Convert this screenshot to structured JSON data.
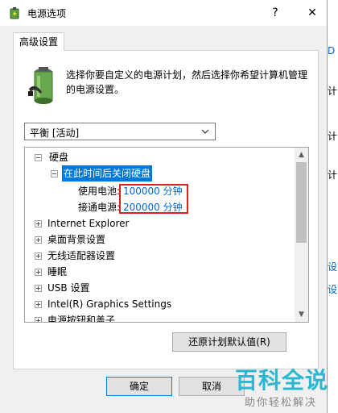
{
  "window": {
    "title": "电源选项",
    "help_label": "?",
    "close_label": "✕"
  },
  "tabs": [
    {
      "label": "高级设置"
    }
  ],
  "description": "选择你要自定义的电源计划，然后选择你希望计算机管理的电源设置。",
  "plan_select": {
    "value": "平衡 [活动]"
  },
  "tree": {
    "hard_disk": "硬盘",
    "turn_off_after": "在此时间后关闭硬盘",
    "on_battery_label": "使用电池:",
    "on_battery_value": "100000 分钟",
    "plugged_in_label": "接通电源:",
    "plugged_in_value": "200000 分钟",
    "items": [
      "Internet Explorer",
      "桌面背景设置",
      "无线适配器设置",
      "睡眠",
      "USB 设置",
      "Intel(R) Graphics Settings",
      "电源按钮和盖子"
    ]
  },
  "buttons": {
    "restore_defaults": "还原计划默认值(R)",
    "ok": "确定",
    "cancel": "取消"
  },
  "watermark": {
    "main": "百科全说",
    "sub": "助你轻松解决"
  },
  "background_window": {
    "char_top": "D",
    "char_mid1": "计",
    "char_mid2": "计",
    "char_mid3": "计",
    "char_low1": "设",
    "char_low2": "设"
  },
  "colors": {
    "selection": "#0078d7",
    "value_link": "#0066cc",
    "highlight_box": "#e02020",
    "watermark": "#2ab8d0"
  }
}
